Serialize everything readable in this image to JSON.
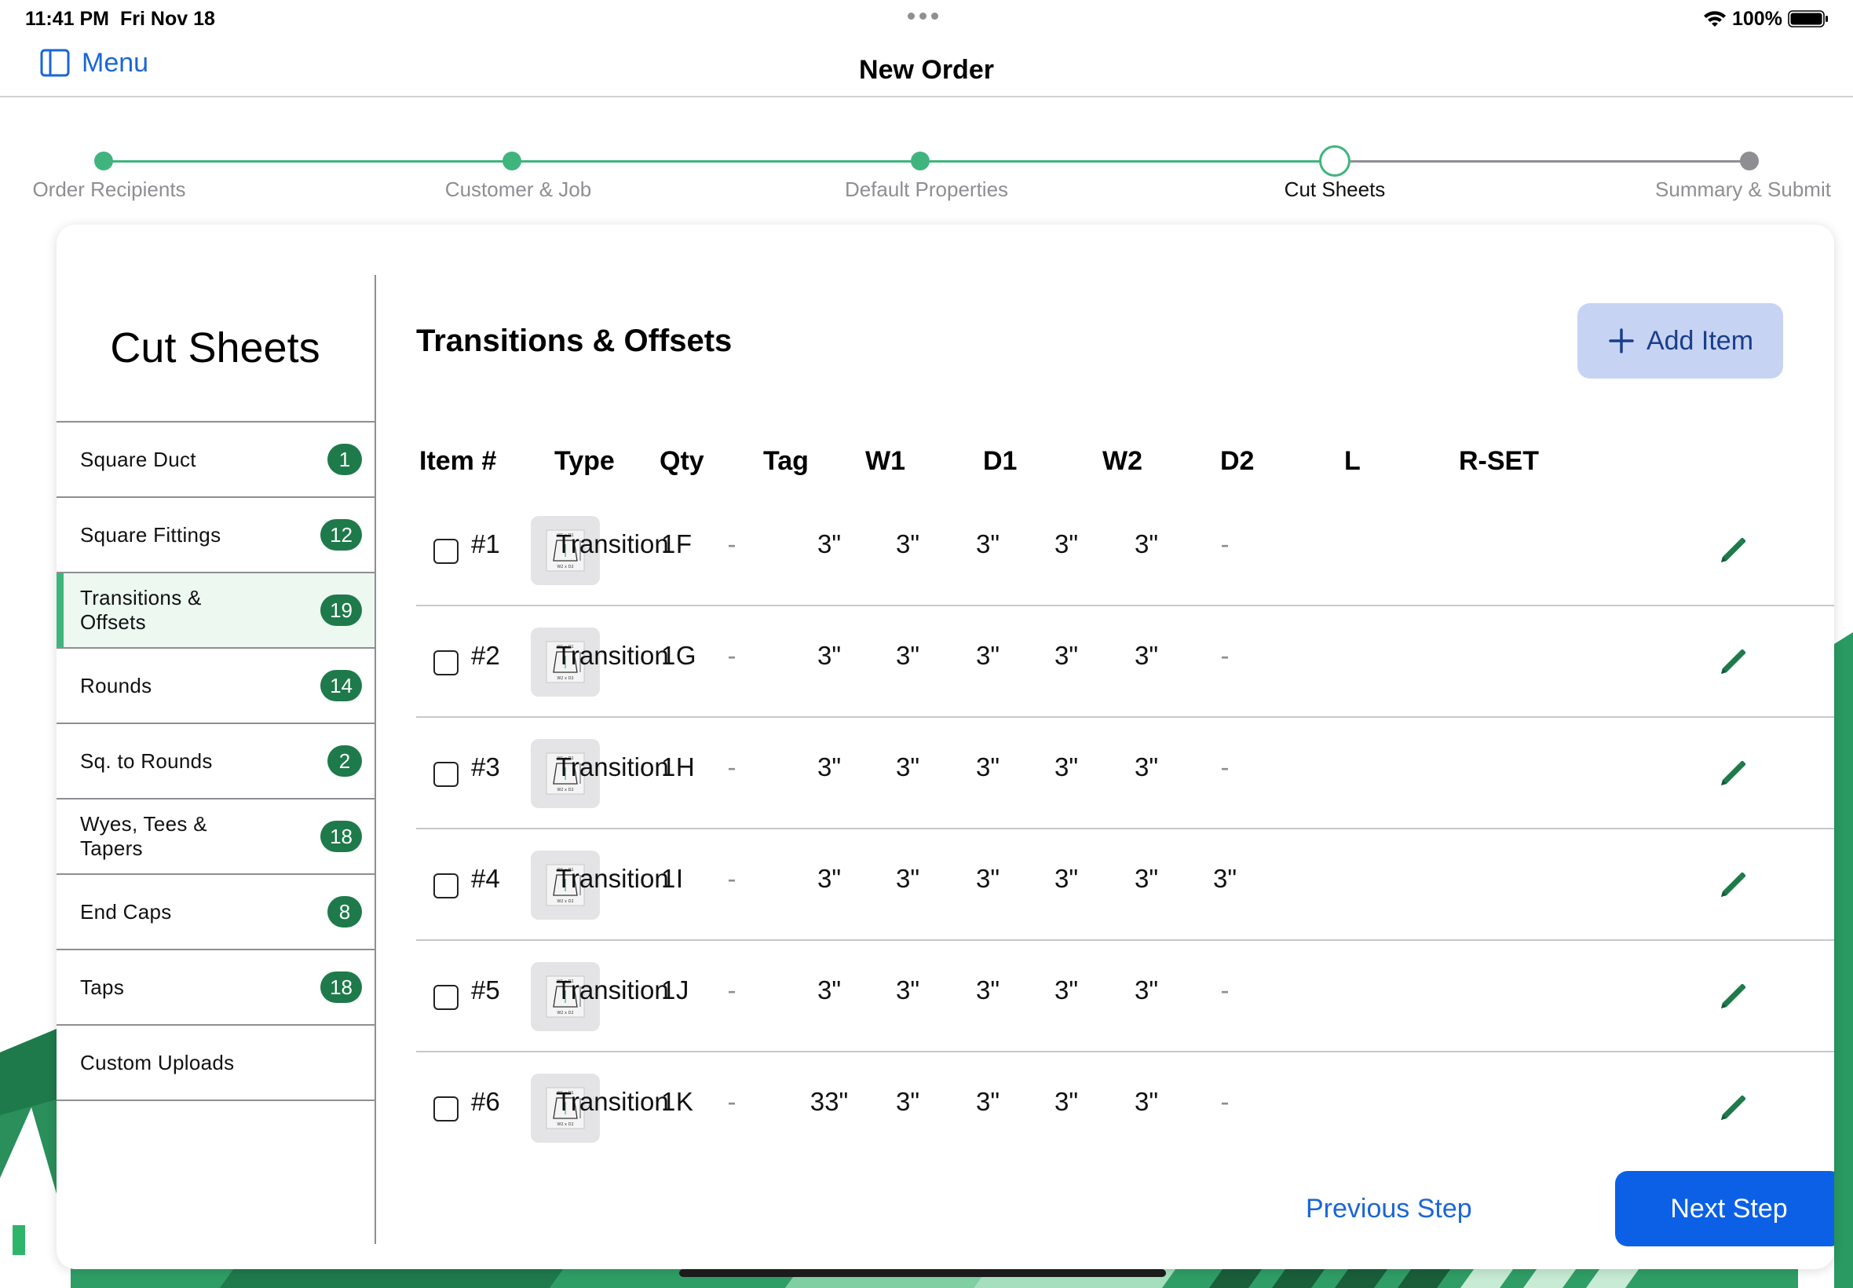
{
  "status_bar": {
    "time": "11:41 PM",
    "date": "Fri Nov 18",
    "battery": "100%"
  },
  "nav": {
    "menu_label": "Menu",
    "title": "New Order"
  },
  "stepper": {
    "steps": [
      {
        "label": "Order Recipients",
        "state": "done"
      },
      {
        "label": "Customer & Job",
        "state": "done"
      },
      {
        "label": "Default Properties",
        "state": "done"
      },
      {
        "label": "Cut Sheets",
        "state": "current"
      },
      {
        "label": "Summary & Submit",
        "state": "todo"
      }
    ]
  },
  "sidebar": {
    "title": "Cut Sheets",
    "items": [
      {
        "label": "Square Duct",
        "count": "1"
      },
      {
        "label": "Square Fittings",
        "count": "12"
      },
      {
        "label": "Transitions & Offsets",
        "count": "19",
        "active": true
      },
      {
        "label": "Rounds",
        "count": "14"
      },
      {
        "label": "Sq. to Rounds",
        "count": "2"
      },
      {
        "label": "Wyes, Tees & Tapers",
        "count": "18"
      },
      {
        "label": "End Caps",
        "count": "8"
      },
      {
        "label": "Taps",
        "count": "18"
      },
      {
        "label": "Custom Uploads",
        "count": ""
      }
    ]
  },
  "main": {
    "section_title": "Transitions & Offsets",
    "add_item_label": "Add Item"
  },
  "table": {
    "columns": [
      "Item #",
      "Type",
      "Qty",
      "Tag",
      "W1",
      "D1",
      "W2",
      "D2",
      "L",
      "R-SET"
    ],
    "rows": [
      {
        "item": "#1",
        "type": "Transition F",
        "qty": "1",
        "tag": "-",
        "w1": "3\"",
        "d1": "3\"",
        "w2": "3\"",
        "d2": "3\"",
        "l": "3\"",
        "rset": "-"
      },
      {
        "item": "#2",
        "type": "Transition G",
        "qty": "1",
        "tag": "-",
        "w1": "3\"",
        "d1": "3\"",
        "w2": "3\"",
        "d2": "3\"",
        "l": "3\"",
        "rset": "-"
      },
      {
        "item": "#3",
        "type": "Transition H",
        "qty": "1",
        "tag": "-",
        "w1": "3\"",
        "d1": "3\"",
        "w2": "3\"",
        "d2": "3\"",
        "l": "3\"",
        "rset": "-"
      },
      {
        "item": "#4",
        "type": "Transition I",
        "qty": "1",
        "tag": "-",
        "w1": "3\"",
        "d1": "3\"",
        "w2": "3\"",
        "d2": "3\"",
        "l": "3\"",
        "rset": "3\""
      },
      {
        "item": "#5",
        "type": "Transition J",
        "qty": "1",
        "tag": "-",
        "w1": "3\"",
        "d1": "3\"",
        "w2": "3\"",
        "d2": "3\"",
        "l": "3\"",
        "rset": "-"
      },
      {
        "item": "#6",
        "type": "Transition K",
        "qty": "1",
        "tag": "-",
        "w1": "33\"",
        "d1": "3\"",
        "w2": "3\"",
        "d2": "3\"",
        "l": "3\"",
        "rset": "-"
      }
    ]
  },
  "footer": {
    "previous_label": "Previous Step",
    "next_label": "Next Step"
  },
  "colors": {
    "accent_green": "#3fb57d",
    "badge_green": "#1e7a4a",
    "link_blue": "#1a66d6",
    "primary_blue": "#0b60e6",
    "add_item_bg": "#c6d3f3"
  },
  "icons": {
    "menu": "sidebar-toggle-icon",
    "add": "plus-icon",
    "edit": "pencil-icon",
    "thumbnail": "transition-diagram-icon"
  }
}
